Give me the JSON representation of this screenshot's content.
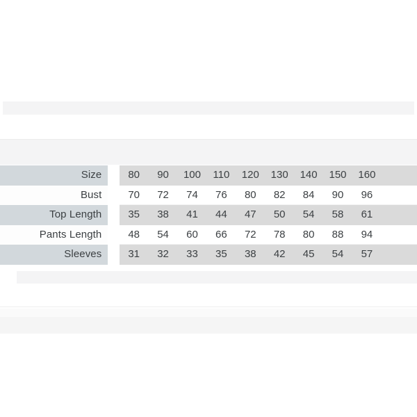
{
  "chart_data": {
    "type": "table",
    "title": "",
    "columns": [
      "Size",
      "80",
      "90",
      "100",
      "110",
      "120",
      "130",
      "140",
      "150",
      "160"
    ],
    "row_labels": [
      "Size",
      "Bust",
      "Top Length",
      "Pants Length",
      "Sleeves"
    ],
    "rows": [
      {
        "label": "Size",
        "values": [
          "80",
          "90",
          "100",
          "110",
          "120",
          "130",
          "140",
          "150",
          "160"
        ]
      },
      {
        "label": "Bust",
        "values": [
          "70",
          "72",
          "74",
          "76",
          "80",
          "82",
          "84",
          "90",
          "96"
        ]
      },
      {
        "label": "Top Length",
        "values": [
          "35",
          "38",
          "41",
          "44",
          "47",
          "50",
          "54",
          "58",
          "61"
        ]
      },
      {
        "label": "Pants Length",
        "values": [
          "48",
          "54",
          "60",
          "66",
          "72",
          "78",
          "80",
          "88",
          "94"
        ]
      },
      {
        "label": "Sleeves",
        "values": [
          "31",
          "32",
          "33",
          "35",
          "38",
          "42",
          "45",
          "54",
          "57"
        ]
      }
    ],
    "colors": {
      "label_cell_shaded": "#d2d8dc",
      "data_cell_shaded": "#dadada",
      "cell_plain": "#ffffff",
      "text": "#3b3f42",
      "page_background": "#ffffff",
      "ghost_band": "#f4f4f5"
    }
  }
}
